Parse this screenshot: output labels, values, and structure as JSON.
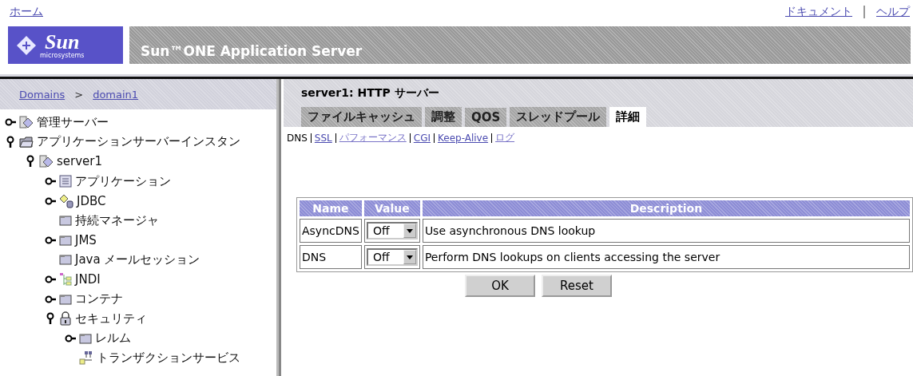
{
  "top_links": {
    "home": "ホーム",
    "right": [
      "ドキュメント",
      "ヘルプ"
    ]
  },
  "header": {
    "logo": {
      "text": "Sun",
      "subtext": "microsystems"
    },
    "title": "Sun™ONE Application Server"
  },
  "breadcrumb": [
    "Domains",
    "domain1"
  ],
  "breadcrumb_separator": ">",
  "tree": [
    {
      "label": "管理サーバー",
      "kind": "server",
      "expanded": false
    },
    {
      "label": "アプリケーションサーバーインスタン",
      "kind": "folder-open",
      "expanded": true,
      "children": [
        {
          "label": "server1",
          "kind": "server",
          "expanded": true,
          "children": [
            {
              "label": "アプリケーション",
              "kind": "list",
              "expanded": false
            },
            {
              "label": "JDBC",
              "kind": "database",
              "expanded": false
            },
            {
              "label": "持続マネージャ",
              "kind": "folder"
            },
            {
              "label": "JMS",
              "kind": "folder",
              "expanded": false
            },
            {
              "label": "Java メールセッション",
              "kind": "folder"
            },
            {
              "label": "JNDI",
              "kind": "tree",
              "expanded": false
            },
            {
              "label": "コンテナ",
              "kind": "folder",
              "expanded": false
            },
            {
              "label": "セキュリティ",
              "kind": "lock",
              "expanded": true,
              "children": [
                {
                  "label": "レルム",
                  "kind": "folder",
                  "expanded": false
                },
                {
                  "label": "トランザクションサービス",
                  "kind": "network"
                }
              ]
            }
          ]
        }
      ]
    }
  ],
  "page_title": "server1: HTTP サーバー",
  "tabs": [
    {
      "label": "ファイルキャッシュ",
      "selected": false
    },
    {
      "label": "調整",
      "selected": false
    },
    {
      "label": "QOS",
      "selected": false
    },
    {
      "label": "スレッドプール",
      "selected": false
    },
    {
      "label": "詳細",
      "selected": true
    }
  ],
  "sublinks": [
    {
      "label": "DNS",
      "kind": "current"
    },
    {
      "label": "SSL",
      "kind": "link"
    },
    {
      "label": "パフォーマンス",
      "kind": "visited"
    },
    {
      "label": "CGI",
      "kind": "link"
    },
    {
      "label": "Keep-Alive",
      "kind": "link"
    },
    {
      "label": "ログ",
      "kind": "visited"
    }
  ],
  "table": {
    "columns": [
      "Name",
      "Value",
      "Description"
    ],
    "rows": [
      {
        "name": "AsyncDNS",
        "value": "Off",
        "description": "Use asynchronous DNS lookup"
      },
      {
        "name": "DNS",
        "value": "Off",
        "description": "Perform DNS lookups on clients accessing the server"
      }
    ]
  },
  "buttons": [
    "OK",
    "Reset"
  ]
}
